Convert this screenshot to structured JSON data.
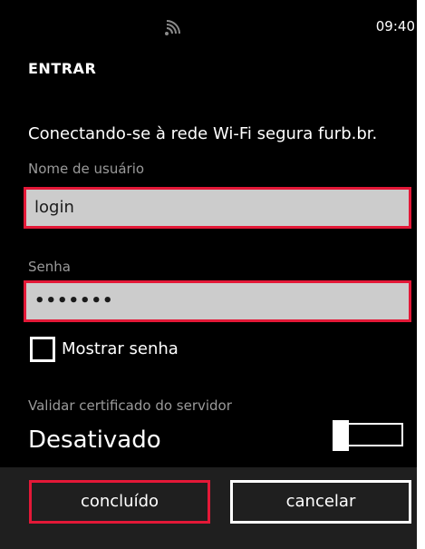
{
  "status_bar": {
    "signal_icon": "wifi-signal-icon",
    "time": "09:40"
  },
  "page": {
    "title": "ENTRAR",
    "description": "Conectando-se à rede Wi-Fi segura furb.br."
  },
  "form": {
    "username_label": "Nome de usuário",
    "username_value": "login",
    "password_label": "Senha",
    "password_value": "•••••••",
    "show_password_label": "Mostrar senha",
    "show_password_checked": false,
    "validate_label": "Validar certificado do servidor",
    "validate_value": "Desativado",
    "validate_enabled": false
  },
  "app_bar": {
    "done_label": "concluído",
    "cancel_label": "cancelar"
  },
  "colors": {
    "background": "#000000",
    "highlight": "#e31837",
    "textbox_bg": "#cccccc",
    "app_bar_bg": "#1f1f1f"
  }
}
